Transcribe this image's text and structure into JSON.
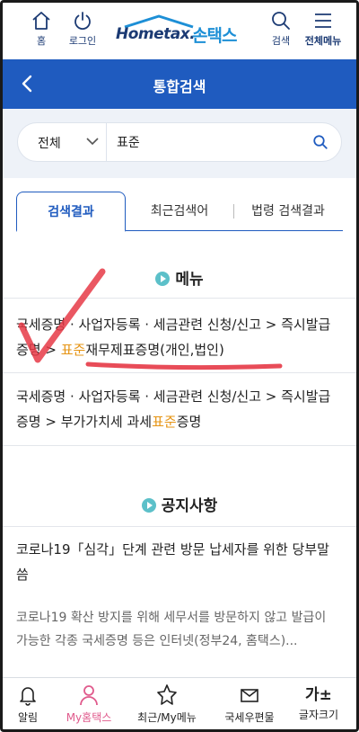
{
  "header": {
    "home_label": "홈",
    "login_label": "로그인",
    "logo_text": "Hometax.",
    "logo_korean": "손택스",
    "search_label": "검색",
    "menu_label": "전체메뉴"
  },
  "titlebar": {
    "title": "통합검색"
  },
  "search": {
    "scope": "전체",
    "query": "표준"
  },
  "tabs": [
    {
      "label": "검색결과",
      "active": true
    },
    {
      "label": "최근검색어",
      "active": false
    },
    {
      "label": "법령 검색결과",
      "active": false
    }
  ],
  "menu_section": {
    "title": "메뉴",
    "results": [
      {
        "before": "국세증명 · 사업자등록 · 세금관련 신청/신고 > 즉시발급 증명 > ",
        "highlight": "표준",
        "after": "재무제표증명(개인,법인)"
      },
      {
        "before": "국세증명 · 사업자등록 · 세금관련 신청/신고 > 즉시발급 증명 > 부가가치세 과세",
        "highlight": "표준",
        "after": "증명"
      }
    ]
  },
  "notice_section": {
    "title": "공지사항",
    "item_title": "코로나19「심각」단계 관련 방문 납세자를 위한 당부말씀",
    "item_body": "코로나19 확산 방지를 위해 세무서를 방문하지 않고 발급이 가능한 각종 국세증명 등은 인터넷(정부24, 홈택스)..."
  },
  "bottom_nav": [
    {
      "label": "알림",
      "icon": "bell-icon"
    },
    {
      "label": "My홈택스",
      "icon": "person-icon",
      "active": true
    },
    {
      "label": "최근/My메뉴",
      "icon": "star-icon"
    },
    {
      "label": "국세우편물",
      "icon": "mail-icon"
    },
    {
      "label": "글자크기",
      "icon": "font-size-icon",
      "glyph": "가±"
    }
  ],
  "colors": {
    "primary": "#1f5bbf",
    "highlight": "#e69414",
    "active_nav": "#e05a8c",
    "annotation": "#e63946"
  }
}
